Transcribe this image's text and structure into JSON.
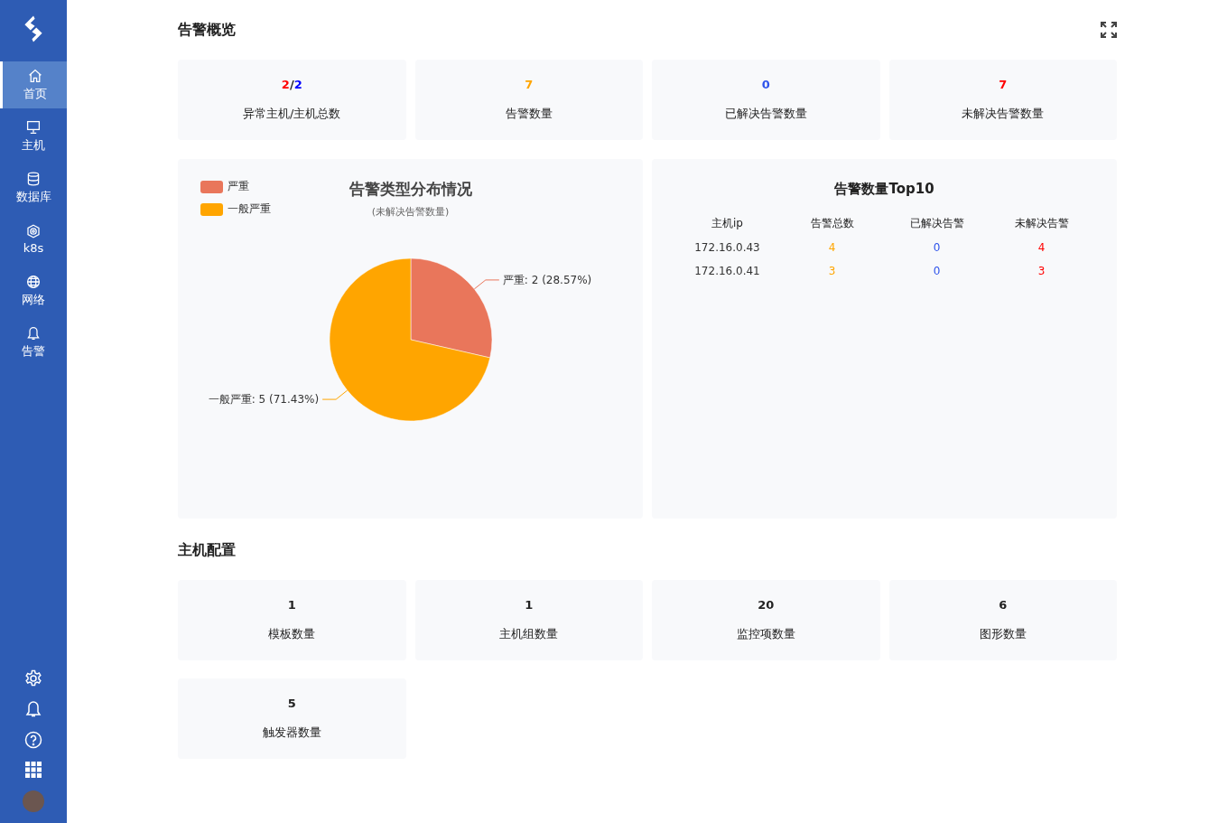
{
  "sidebar": {
    "items": [
      {
        "label": "首页",
        "selected": true
      },
      {
        "label": "主机",
        "selected": false
      },
      {
        "label": "数据库",
        "selected": false
      },
      {
        "label": "k8s",
        "selected": false
      },
      {
        "label": "网络",
        "selected": false
      },
      {
        "label": "告警",
        "selected": false
      }
    ]
  },
  "alert_overview": {
    "title": "告警概览",
    "cards": [
      {
        "value_parts": [
          {
            "text": "2",
            "color": "#ff0000"
          },
          {
            "text": "/",
            "color": "#222222"
          },
          {
            "text": "2",
            "color": "#0000ff"
          }
        ],
        "label": "异常主机/主机总数"
      },
      {
        "value_parts": [
          {
            "text": "7",
            "color": "#ffa500"
          }
        ],
        "label": "告警数量"
      },
      {
        "value_parts": [
          {
            "text": "0",
            "color": "#2f54eb"
          }
        ],
        "label": "已解决告警数量"
      },
      {
        "value_parts": [
          {
            "text": "7",
            "color": "#ff0000"
          }
        ],
        "label": "未解决告警数量"
      }
    ],
    "pie_panel": {
      "legend": [
        {
          "label": "严重",
          "color": "#e9765b"
        },
        {
          "label": "一般严重",
          "color": "#ffa500"
        }
      ],
      "subtitle": "(未解决告警数量)",
      "chart_data": {
        "type": "pie",
        "title": "告警类型分布情况",
        "series": [
          {
            "values": [
              28.57,
              71.43
            ]
          }
        ],
        "value_labels": [
          "严重: 2 (28.57%)",
          "一般严重: 5 (71.43%)"
        ]
      }
    },
    "top_table": {
      "title": "告警数量Top10",
      "columns": [
        {
          "label": "主机ip",
          "color": "#333333"
        },
        {
          "label": "告警总数",
          "color": "#ffa500"
        },
        {
          "label": "已解决告警",
          "color": "#2f54eb"
        },
        {
          "label": "未解决告警",
          "color": "#ff0000"
        }
      ],
      "rows": [
        [
          "172.16.0.43",
          "4",
          "0",
          "4"
        ],
        [
          "172.16.0.41",
          "3",
          "0",
          "3"
        ]
      ]
    }
  },
  "host_config": {
    "title": "主机配置",
    "cards": [
      {
        "value": "1",
        "label": "模板数量"
      },
      {
        "value": "1",
        "label": "主机组数量"
      },
      {
        "value": "20",
        "label": "监控项数量"
      },
      {
        "value": "6",
        "label": "图形数量"
      },
      {
        "value": "5",
        "label": "触发器数量"
      }
    ]
  }
}
